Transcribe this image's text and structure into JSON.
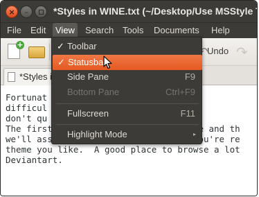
{
  "window": {
    "title": "*Styles in WINE.txt (~/Desktop/Use MSStyle T",
    "controls": {
      "close": "×",
      "minimize": "–"
    }
  },
  "menubar": {
    "items": [
      {
        "label": "File"
      },
      {
        "label": "Edit"
      },
      {
        "label": "View",
        "active": true
      },
      {
        "label": "Search"
      },
      {
        "label": "Tools"
      },
      {
        "label": "Documents"
      },
      {
        "label": "Help"
      }
    ]
  },
  "toolbar": {
    "undo_label": "Undo"
  },
  "tab": {
    "label": "*Styles i"
  },
  "editor": {
    "lines": [
      "Fortunat             ot MSStyle",
      "difficul             cations lo",
      "don't qu             desktop.",
      "",
      "The first step - after installing Wine and th",
      "we'll assume you know how to do, if you're re",
      "theme you like.  A good place to browse a lot",
      "Deviantart."
    ]
  },
  "view_menu": {
    "items": [
      {
        "label": "Toolbar",
        "checked": true,
        "accel": "",
        "state": "normal"
      },
      {
        "label": "Statusbar",
        "checked": true,
        "accel": "",
        "state": "hover"
      },
      {
        "label": "Side Pane",
        "checked": false,
        "accel": "F9",
        "state": "normal"
      },
      {
        "label": "Bottom Pane",
        "checked": false,
        "accel": "Ctrl+F9",
        "state": "disabled"
      },
      {
        "label": "Fullscreen",
        "checked": false,
        "accel": "F11",
        "state": "normal"
      },
      {
        "label": "Highlight Mode",
        "checked": false,
        "accel": "",
        "submenu": true,
        "state": "normal"
      }
    ],
    "check_glyph": "✓",
    "submenu_glyph": "▸"
  },
  "colors": {
    "titlebar": "#3c3b37",
    "menu_highlight": "#e95420",
    "editor_text": "#2e3436"
  }
}
